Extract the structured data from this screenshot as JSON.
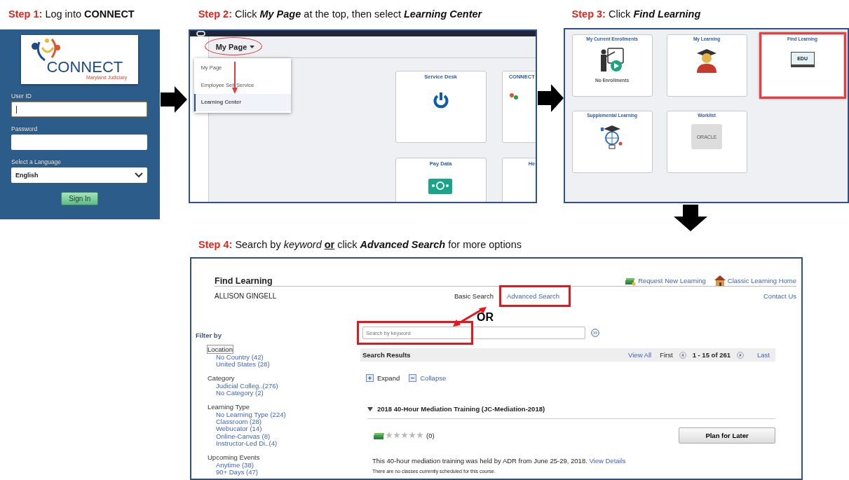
{
  "steps": [
    {
      "label": "Step 1:",
      "text": "Log into **CONNECT**"
    },
    {
      "label": "Step 2:",
      "text": "Click **My Page** at the top, then select **Learning Center**"
    },
    {
      "label": "Step 3:",
      "text": "Click **Find Learning**"
    },
    {
      "label": "Step 4:",
      "text": "Search by *keyword* **or** click **Advanced Search** for more options"
    }
  ],
  "login": {
    "logo_text": "CONNECT",
    "logo_subtext": "Maryland Judiciary",
    "fields": [
      {
        "label": "User ID",
        "kind": "text",
        "focused": true
      },
      {
        "label": "Password",
        "kind": "password",
        "focused": false
      },
      {
        "label": "Select a Language",
        "kind": "select",
        "value": "English",
        "focused": false
      }
    ],
    "button": "Sign In"
  },
  "portal": {
    "menu_button": "My Page",
    "menu_items": [
      {
        "label": "My Page",
        "selected": false
      },
      {
        "label": "Employee Self Service",
        "selected": false
      },
      {
        "label": "Learning Center",
        "selected": true
      }
    ],
    "tiles": [
      {
        "title": "Service Desk",
        "kind": "power"
      },
      {
        "title": "CONNECT",
        "kind": "logo"
      },
      {
        "title": "Pay Data",
        "kind": "money"
      },
      {
        "title": "He",
        "kind": "none"
      }
    ]
  },
  "learning_center": {
    "tiles": [
      {
        "title": "My Current Enrollments",
        "subtitle": "No Enrollments",
        "kind": "presenter",
        "highlighted": false
      },
      {
        "title": "My Learning",
        "kind": "graduate",
        "highlighted": false
      },
      {
        "title": "Find Learning",
        "kind": "laptop",
        "icon_text": "EDU",
        "highlighted": true
      },
      {
        "title": "Supplemental Learning",
        "kind": "globe",
        "highlighted": false
      },
      {
        "title": "Worklist",
        "kind": "oracle",
        "icon_text": "ORACLE",
        "highlighted": false
      }
    ]
  },
  "find_learning": {
    "title": "Find Learning",
    "header_links": [
      {
        "label": "Request New Learning",
        "kind": "books"
      },
      {
        "label": "Classic Learning Home",
        "kind": "house"
      }
    ],
    "user": "ALLISON GINGELL",
    "search_modes": [
      {
        "label": "Basic Search",
        "selected": true,
        "highlighted": false
      },
      {
        "label": "Advanced Search",
        "selected": false,
        "highlighted": true
      }
    ],
    "contact": "Contact Us",
    "or_label": "OR",
    "search": {
      "placeholder": "Search by keyword",
      "highlighted": true
    },
    "filter_title": "Filter by",
    "filters": [
      {
        "name": "Location",
        "focused": true,
        "options": [
          "No Country (42)",
          "United States (28)"
        ]
      },
      {
        "name": "Category",
        "focused": false,
        "options": [
          "Judicial Colleg..(276)",
          "No Category (2)"
        ]
      },
      {
        "name": "Learning Type",
        "focused": false,
        "options": [
          "No Learning Type (224)",
          "Classroom (28)",
          "Webucator (14)",
          "Online-Canvas (8)",
          "Instructor-Led Di..(4)"
        ]
      },
      {
        "name": "Upcoming Events",
        "focused": false,
        "options": [
          "Anytime (38)",
          "90+ Days (47)"
        ]
      }
    ],
    "results": {
      "title": "Search Results",
      "view_all": "View All",
      "first": "First",
      "range": "1 - 15 of 261",
      "last": "Last",
      "expand": "Expand",
      "collapse": "Collapse",
      "course": {
        "title": "2018 40-Hour Mediation Training (JC-Mediation-2018)",
        "expanded": true,
        "stars": 0,
        "rating_count": "(0)",
        "button": "Plan for Later",
        "description": "This 40-hour mediation training was held by ADR from June 25-29, 2018.",
        "details_link": "View Details",
        "note": "There are no classes currently scheduled for this course."
      }
    }
  }
}
